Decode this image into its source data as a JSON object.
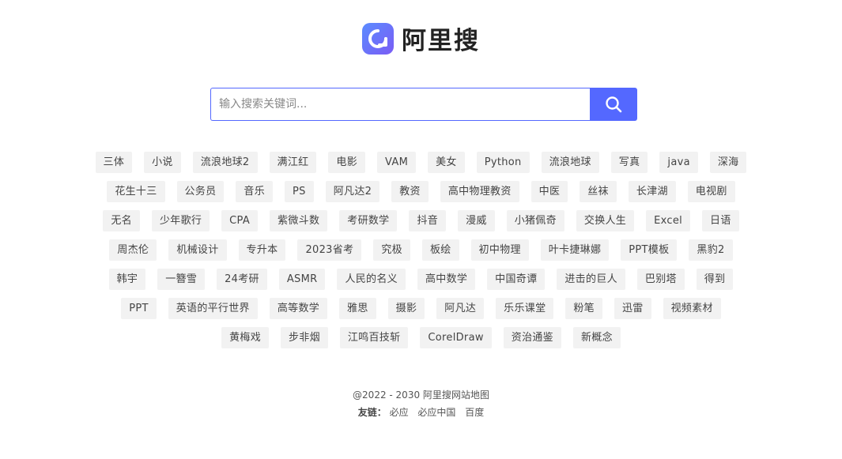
{
  "brand": {
    "name": "阿里搜",
    "accent": "#5468ff",
    "logo_gradient": [
      "#5b8cff",
      "#7a5cf5"
    ]
  },
  "search": {
    "placeholder": "输入搜索关键词...",
    "value": "",
    "button_icon": "search-icon"
  },
  "tags": [
    "三体",
    "小说",
    "流浪地球2",
    "满江红",
    "电影",
    "VAM",
    "美女",
    "Python",
    "流浪地球",
    "写真",
    "java",
    "深海",
    "花生十三",
    "公务员",
    "音乐",
    "PS",
    "阿凡达2",
    "教资",
    "高中物理教资",
    "中医",
    "丝袜",
    "长津湖",
    "电视剧",
    "无名",
    "少年歌行",
    "CPA",
    "紫微斗数",
    "考研数学",
    "抖音",
    "漫威",
    "小猪佩奇",
    "交换人生",
    "Excel",
    "日语",
    "周杰伦",
    "机械设计",
    "专升本",
    "2023省考",
    "究极",
    "板绘",
    "初中物理",
    "叶卡捷琳娜",
    "PPT模板",
    "黑豹2",
    "韩宇",
    "一簪雪",
    "24考研",
    "ASMR",
    "人民的名义",
    "高中数学",
    "中国奇谭",
    "进击的巨人",
    "巴别塔",
    "得到",
    "PPT",
    "英语的平行世界",
    "高等数学",
    "雅思",
    "摄影",
    "阿凡达",
    "乐乐课堂",
    "粉笔",
    "迅雷",
    "视频素材",
    "黄梅戏",
    "步非烟",
    "江鸣百技斩",
    "CorelDraw",
    "资治通鉴",
    "新概念"
  ],
  "footer": {
    "copyright": "@2022 - 2030",
    "site_link": "阿里搜",
    "sitemap_link": "网站地图",
    "friends_label": "友链：",
    "friends": [
      "必应",
      "必应中国",
      "百度"
    ]
  }
}
